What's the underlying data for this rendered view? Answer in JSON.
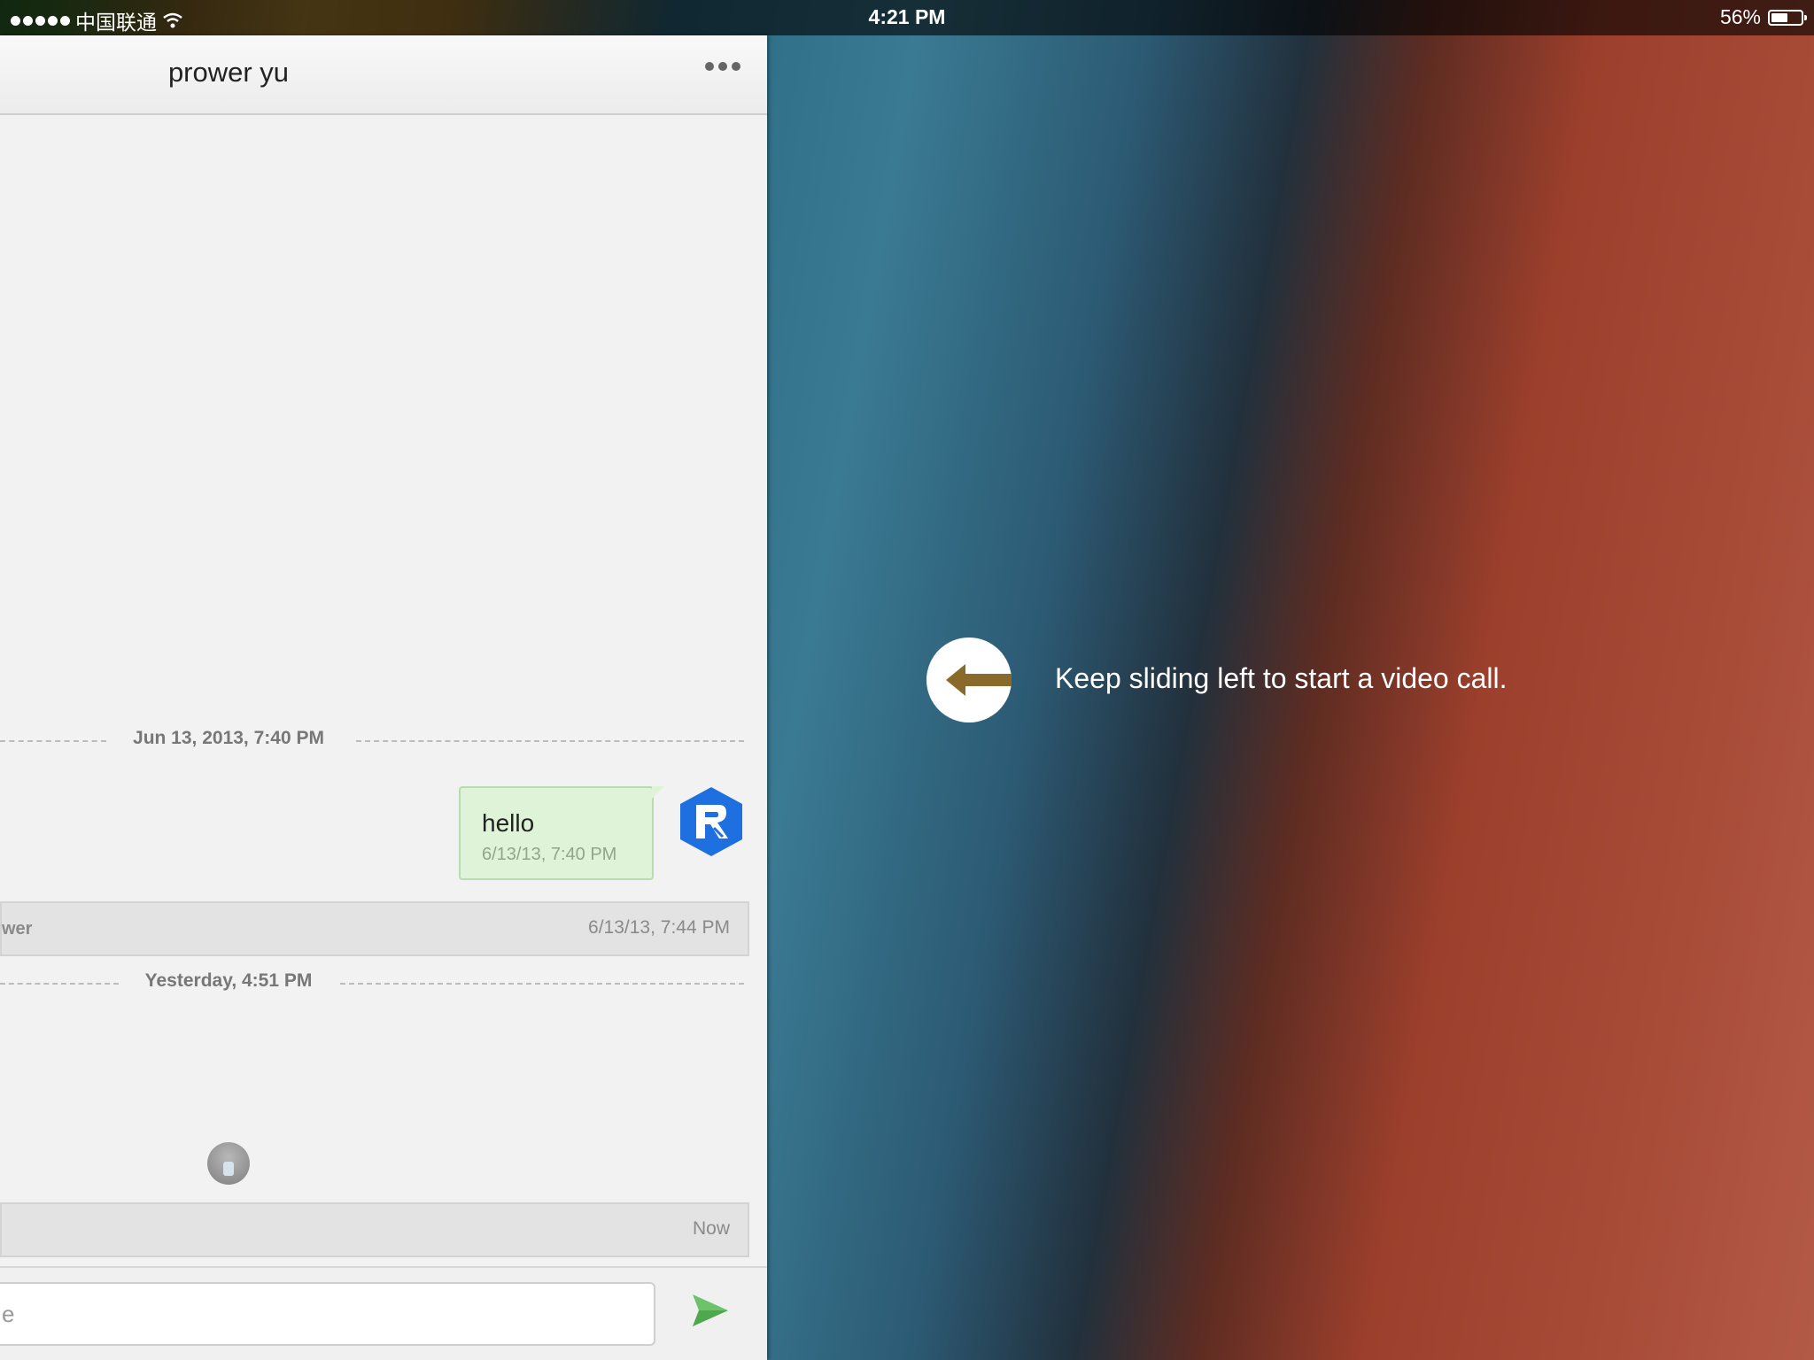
{
  "status_bar": {
    "carrier": "中国联通",
    "time": "4:21 PM",
    "battery_percent": "56%",
    "battery_level": 0.56
  },
  "chat": {
    "title": "prower yu",
    "dividers": [
      {
        "label": "Jun 13, 2013, 7:40 PM"
      },
      {
        "label": "Yesterday, 4:51 PM"
      }
    ],
    "outgoing_message": {
      "text": "hello",
      "time": "6/13/13, 7:40 PM"
    },
    "call_row": {
      "left_text": "wer",
      "time": "6/13/13, 7:44 PM"
    },
    "recent_row": {
      "time": "Now"
    },
    "input": {
      "value": "e"
    }
  },
  "hint": {
    "text": "Keep sliding left to start a video call."
  },
  "colors": {
    "bubble_bg": "#dff3d8",
    "send_green": "#6cc36a",
    "avatar_blue": "#1e6fe0"
  },
  "icons": [
    "wifi-icon",
    "battery-icon",
    "more-icon",
    "app-logo-icon",
    "send-icon",
    "arrow-left-icon"
  ]
}
